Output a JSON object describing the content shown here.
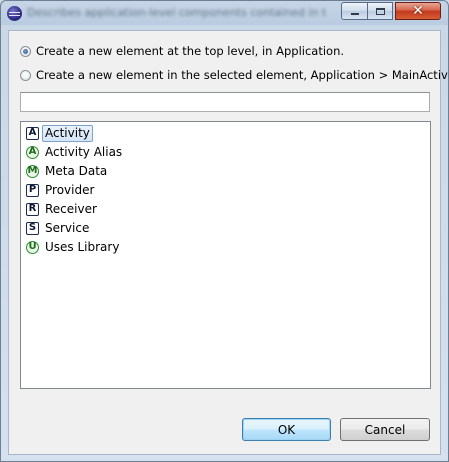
{
  "window": {
    "title_obscured": "Describes application-level components contained in the package, or adds a new one"
  },
  "options": {
    "top_level_label": "Create a new element at the top level, in Application.",
    "selected_element_label": "Create a new element in the selected element, Application > MainActivity.",
    "selected": "top_level"
  },
  "filter": {
    "value": "",
    "placeholder": ""
  },
  "elements": [
    {
      "icon_letter": "A",
      "icon_shape": "square",
      "label": "Activity",
      "selected": true
    },
    {
      "icon_letter": "A",
      "icon_shape": "circle",
      "label": "Activity Alias",
      "selected": false
    },
    {
      "icon_letter": "M",
      "icon_shape": "circle",
      "label": "Meta Data",
      "selected": false
    },
    {
      "icon_letter": "P",
      "icon_shape": "square",
      "label": "Provider",
      "selected": false
    },
    {
      "icon_letter": "R",
      "icon_shape": "square",
      "label": "Receiver",
      "selected": false
    },
    {
      "icon_letter": "S",
      "icon_shape": "square",
      "label": "Service",
      "selected": false
    },
    {
      "icon_letter": "U",
      "icon_shape": "circle",
      "label": "Uses Library",
      "selected": false
    }
  ],
  "buttons": {
    "ok_label": "OK",
    "cancel_label": "Cancel"
  },
  "colors": {
    "square_icon_border": "#1a2b4e",
    "circle_icon_border": "#2e8b2e",
    "selection_border": "#7da2ce",
    "close_button": "#c3391d"
  }
}
